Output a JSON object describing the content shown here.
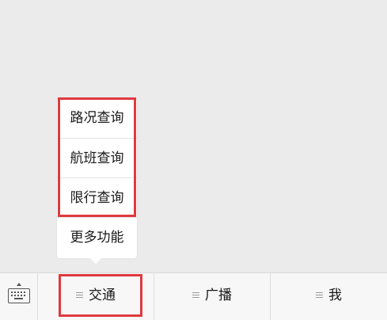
{
  "submenu": {
    "items": [
      {
        "label": "路况查询"
      },
      {
        "label": "航班查询"
      },
      {
        "label": "限行查询"
      },
      {
        "label": "更多功能"
      }
    ]
  },
  "menu_bar": {
    "keyboard_icon": "keyboard-icon",
    "tabs": [
      {
        "label": "交通"
      },
      {
        "label": "广播"
      },
      {
        "label": "我"
      }
    ]
  },
  "colors": {
    "highlight": "#e03a3e",
    "background": "#ebebeb",
    "menu_bar": "#f7f7f7"
  }
}
